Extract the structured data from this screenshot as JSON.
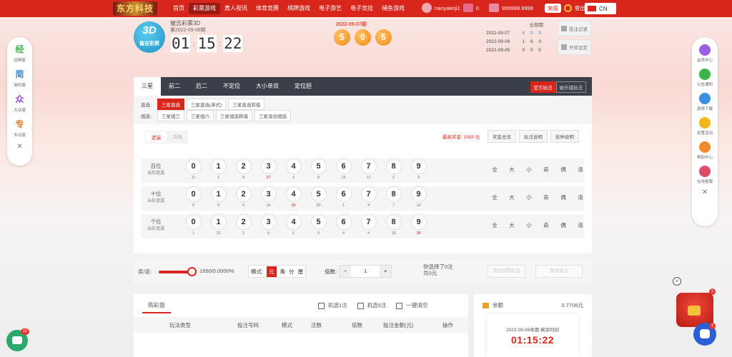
{
  "topbar": {
    "logo": "东方科技",
    "nav": [
      "首页",
      "彩票游戏",
      "真人视讯",
      "体育竞赛",
      "棋牌游戏",
      "电子游艺",
      "电子竞技",
      "捕鱼游戏"
    ],
    "username": "nanyakeji1",
    "messages": "0",
    "balance": "999999.9999",
    "recharge": "充值",
    "logout": "登出",
    "lang": "CN"
  },
  "lottery": {
    "badge_num": "3D",
    "badge_label": "催吉彩票",
    "name": "催吉彩票3D",
    "issue": "第2022-09-08期",
    "timer": {
      "h": "01",
      "m": "15",
      "s": "22"
    },
    "draw_title": "2022-09-07期",
    "draw_balls": [
      "5",
      "0",
      "5"
    ],
    "history_header": "全部期",
    "history": [
      {
        "date": "2022-09-07",
        "num": "5 0 5"
      },
      {
        "date": "2022-09-06",
        "num": "1 6 0"
      },
      {
        "date": "2022-09-05",
        "num": "0 0 5"
      }
    ],
    "bet_record": "投注记录",
    "sound": "开奖设定"
  },
  "left_sidebar": [
    {
      "glyph": "经",
      "label": "经典版",
      "color": "#3bb54a"
    },
    {
      "glyph": "简",
      "label": "简约版",
      "color": "#3a8fe0"
    },
    {
      "glyph": "众",
      "label": "大众版",
      "color": "#9a4fd0"
    },
    {
      "glyph": "专",
      "label": "专业版",
      "color": "#e07a2a"
    }
  ],
  "right_sidebar": [
    {
      "label": "会员中心",
      "color": "#9a5fe0"
    },
    {
      "label": "公告通知",
      "color": "#3bb54a"
    },
    {
      "label": "游戏下载",
      "color": "#3a8fe0"
    },
    {
      "label": "优惠活动",
      "color": "#f2b81a"
    },
    {
      "label": "帮助中心",
      "color": "#f08a2a"
    },
    {
      "label": "在线客服",
      "color": "#e04a6a"
    }
  ],
  "play": {
    "tabs": [
      "三星",
      "前二",
      "后二",
      "不定位",
      "大小单双",
      "定位胆"
    ],
    "mode": [
      "官方玩法",
      "娱乐城玩法"
    ],
    "zhixuan_label": "直选:",
    "zhixuan": [
      "三星直选",
      "三星直选(单式)",
      "三星直选和值"
    ],
    "zuxuan_label": "组选:",
    "zuxuan": [
      "三星组三",
      "三星组六",
      "三星组选和值",
      "三星混合组选"
    ],
    "switch": [
      "遗漏",
      "冷热"
    ],
    "max_prize": "最高奖金: 1950 元",
    "help": [
      "奖金总览",
      "玩法说明",
      "彩种说明"
    ],
    "quick": [
      "全",
      "大",
      "小",
      "奇",
      "偶",
      "清"
    ],
    "rows": [
      {
        "pos": "百位",
        "sub": "当前遗漏",
        "miss": [
          "11",
          "1",
          "8",
          "27",
          "3",
          "8",
          "15",
          "12",
          "2",
          "4"
        ],
        "hot": [
          3
        ]
      },
      {
        "pos": "十位",
        "sub": "当前遗漏",
        "miss": [
          "0",
          "9",
          "5",
          "16",
          "39",
          "20",
          "1",
          "4",
          "7",
          "10"
        ],
        "hot": [
          4
        ]
      },
      {
        "pos": "个位",
        "sub": "当前遗漏",
        "miss": [
          "1",
          "10",
          "3",
          "6",
          "6",
          "0",
          "4",
          "4",
          "18",
          "38"
        ],
        "hot": [
          9
        ]
      }
    ],
    "digits": [
      "0",
      "1",
      "2",
      "3",
      "4",
      "5",
      "6",
      "7",
      "8",
      "9"
    ],
    "rate_label": "奖/返:",
    "rate": "1950/0.0000%",
    "unit_label": "模式:",
    "units": [
      "元",
      "角",
      "分",
      "厘"
    ],
    "mult_label": "倍数:",
    "mult": "1",
    "selected": "你选择了0注",
    "total": "共0元",
    "add_btn": "添加到购彩篮",
    "bet_btn": "直接投注"
  },
  "cart": {
    "title": "购彩篮",
    "actions": [
      "机选1注",
      "机选5注",
      "一键清空"
    ],
    "cols": [
      "玩法类型",
      "投注号码",
      "模式",
      "注数",
      "倍数",
      "投注金额(元)",
      "操作"
    ]
  },
  "balance_box": {
    "label": "余额",
    "value": "0.7706元",
    "ticket_title": "2022-09-08本期 剩余时间",
    "ticket_time": "01:15:22"
  },
  "chat_badge": "10"
}
